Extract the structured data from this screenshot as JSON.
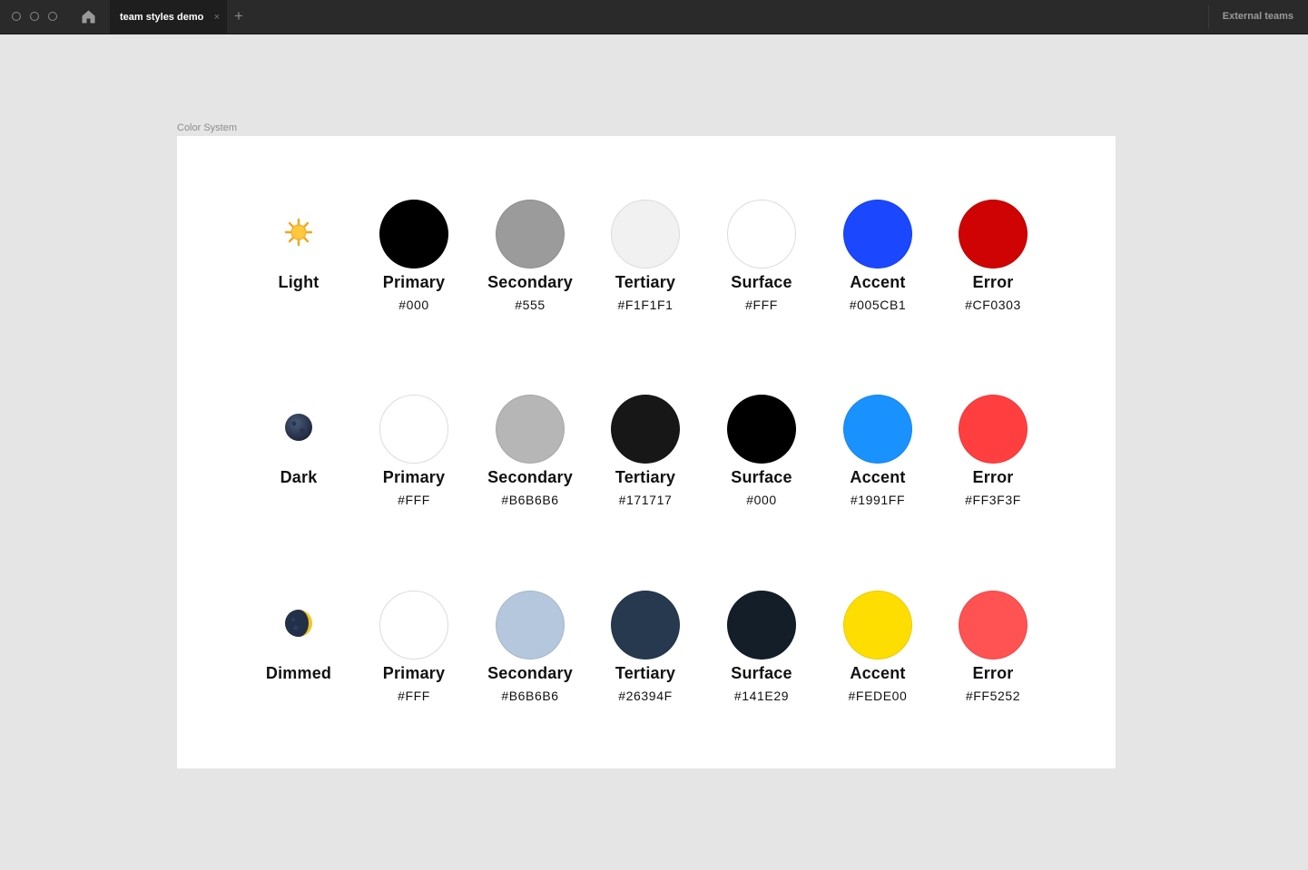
{
  "titlebar": {
    "tab_title": "team styles demo",
    "tab_close": "×",
    "new_tab": "+",
    "right_label": "External teams"
  },
  "canvas": {
    "frame_label": "Color System"
  },
  "themes": [
    {
      "name": "Light",
      "icon": "sun-icon",
      "swatches": [
        {
          "name": "Primary",
          "hex": "#000",
          "color": "#000000"
        },
        {
          "name": "Secondary",
          "hex": "#555",
          "color": "#9b9b9b"
        },
        {
          "name": "Tertiary",
          "hex": "#F1F1F1",
          "color": "#f1f1f1"
        },
        {
          "name": "Surface",
          "hex": "#FFF",
          "color": "#ffffff"
        },
        {
          "name": "Accent",
          "hex": "#005CB1",
          "color": "#1a47ff"
        },
        {
          "name": "Error",
          "hex": "#CF0303",
          "color": "#cf0303"
        }
      ]
    },
    {
      "name": "Dark",
      "icon": "new-moon-icon",
      "swatches": [
        {
          "name": "Primary",
          "hex": "#FFF",
          "color": "#ffffff"
        },
        {
          "name": "Secondary",
          "hex": "#B6B6B6",
          "color": "#b6b6b6"
        },
        {
          "name": "Tertiary",
          "hex": "#171717",
          "color": "#171717"
        },
        {
          "name": "Surface",
          "hex": "#000",
          "color": "#000000"
        },
        {
          "name": "Accent",
          "hex": "#1991FF",
          "color": "#1991ff"
        },
        {
          "name": "Error",
          "hex": "#FF3F3F",
          "color": "#ff3f3f"
        }
      ]
    },
    {
      "name": "Dimmed",
      "icon": "crescent-moon-icon",
      "swatches": [
        {
          "name": "Primary",
          "hex": "#FFF",
          "color": "#ffffff"
        },
        {
          "name": "Secondary",
          "hex": "#B6B6B6",
          "color": "#b5c7dc"
        },
        {
          "name": "Tertiary",
          "hex": "#26394F",
          "color": "#26394f"
        },
        {
          "name": "Surface",
          "hex": "#141E29",
          "color": "#141e29"
        },
        {
          "name": "Accent",
          "hex": "#FEDE00",
          "color": "#fede00"
        },
        {
          "name": "Error",
          "hex": "#FF5252",
          "color": "#ff5252"
        }
      ]
    }
  ]
}
